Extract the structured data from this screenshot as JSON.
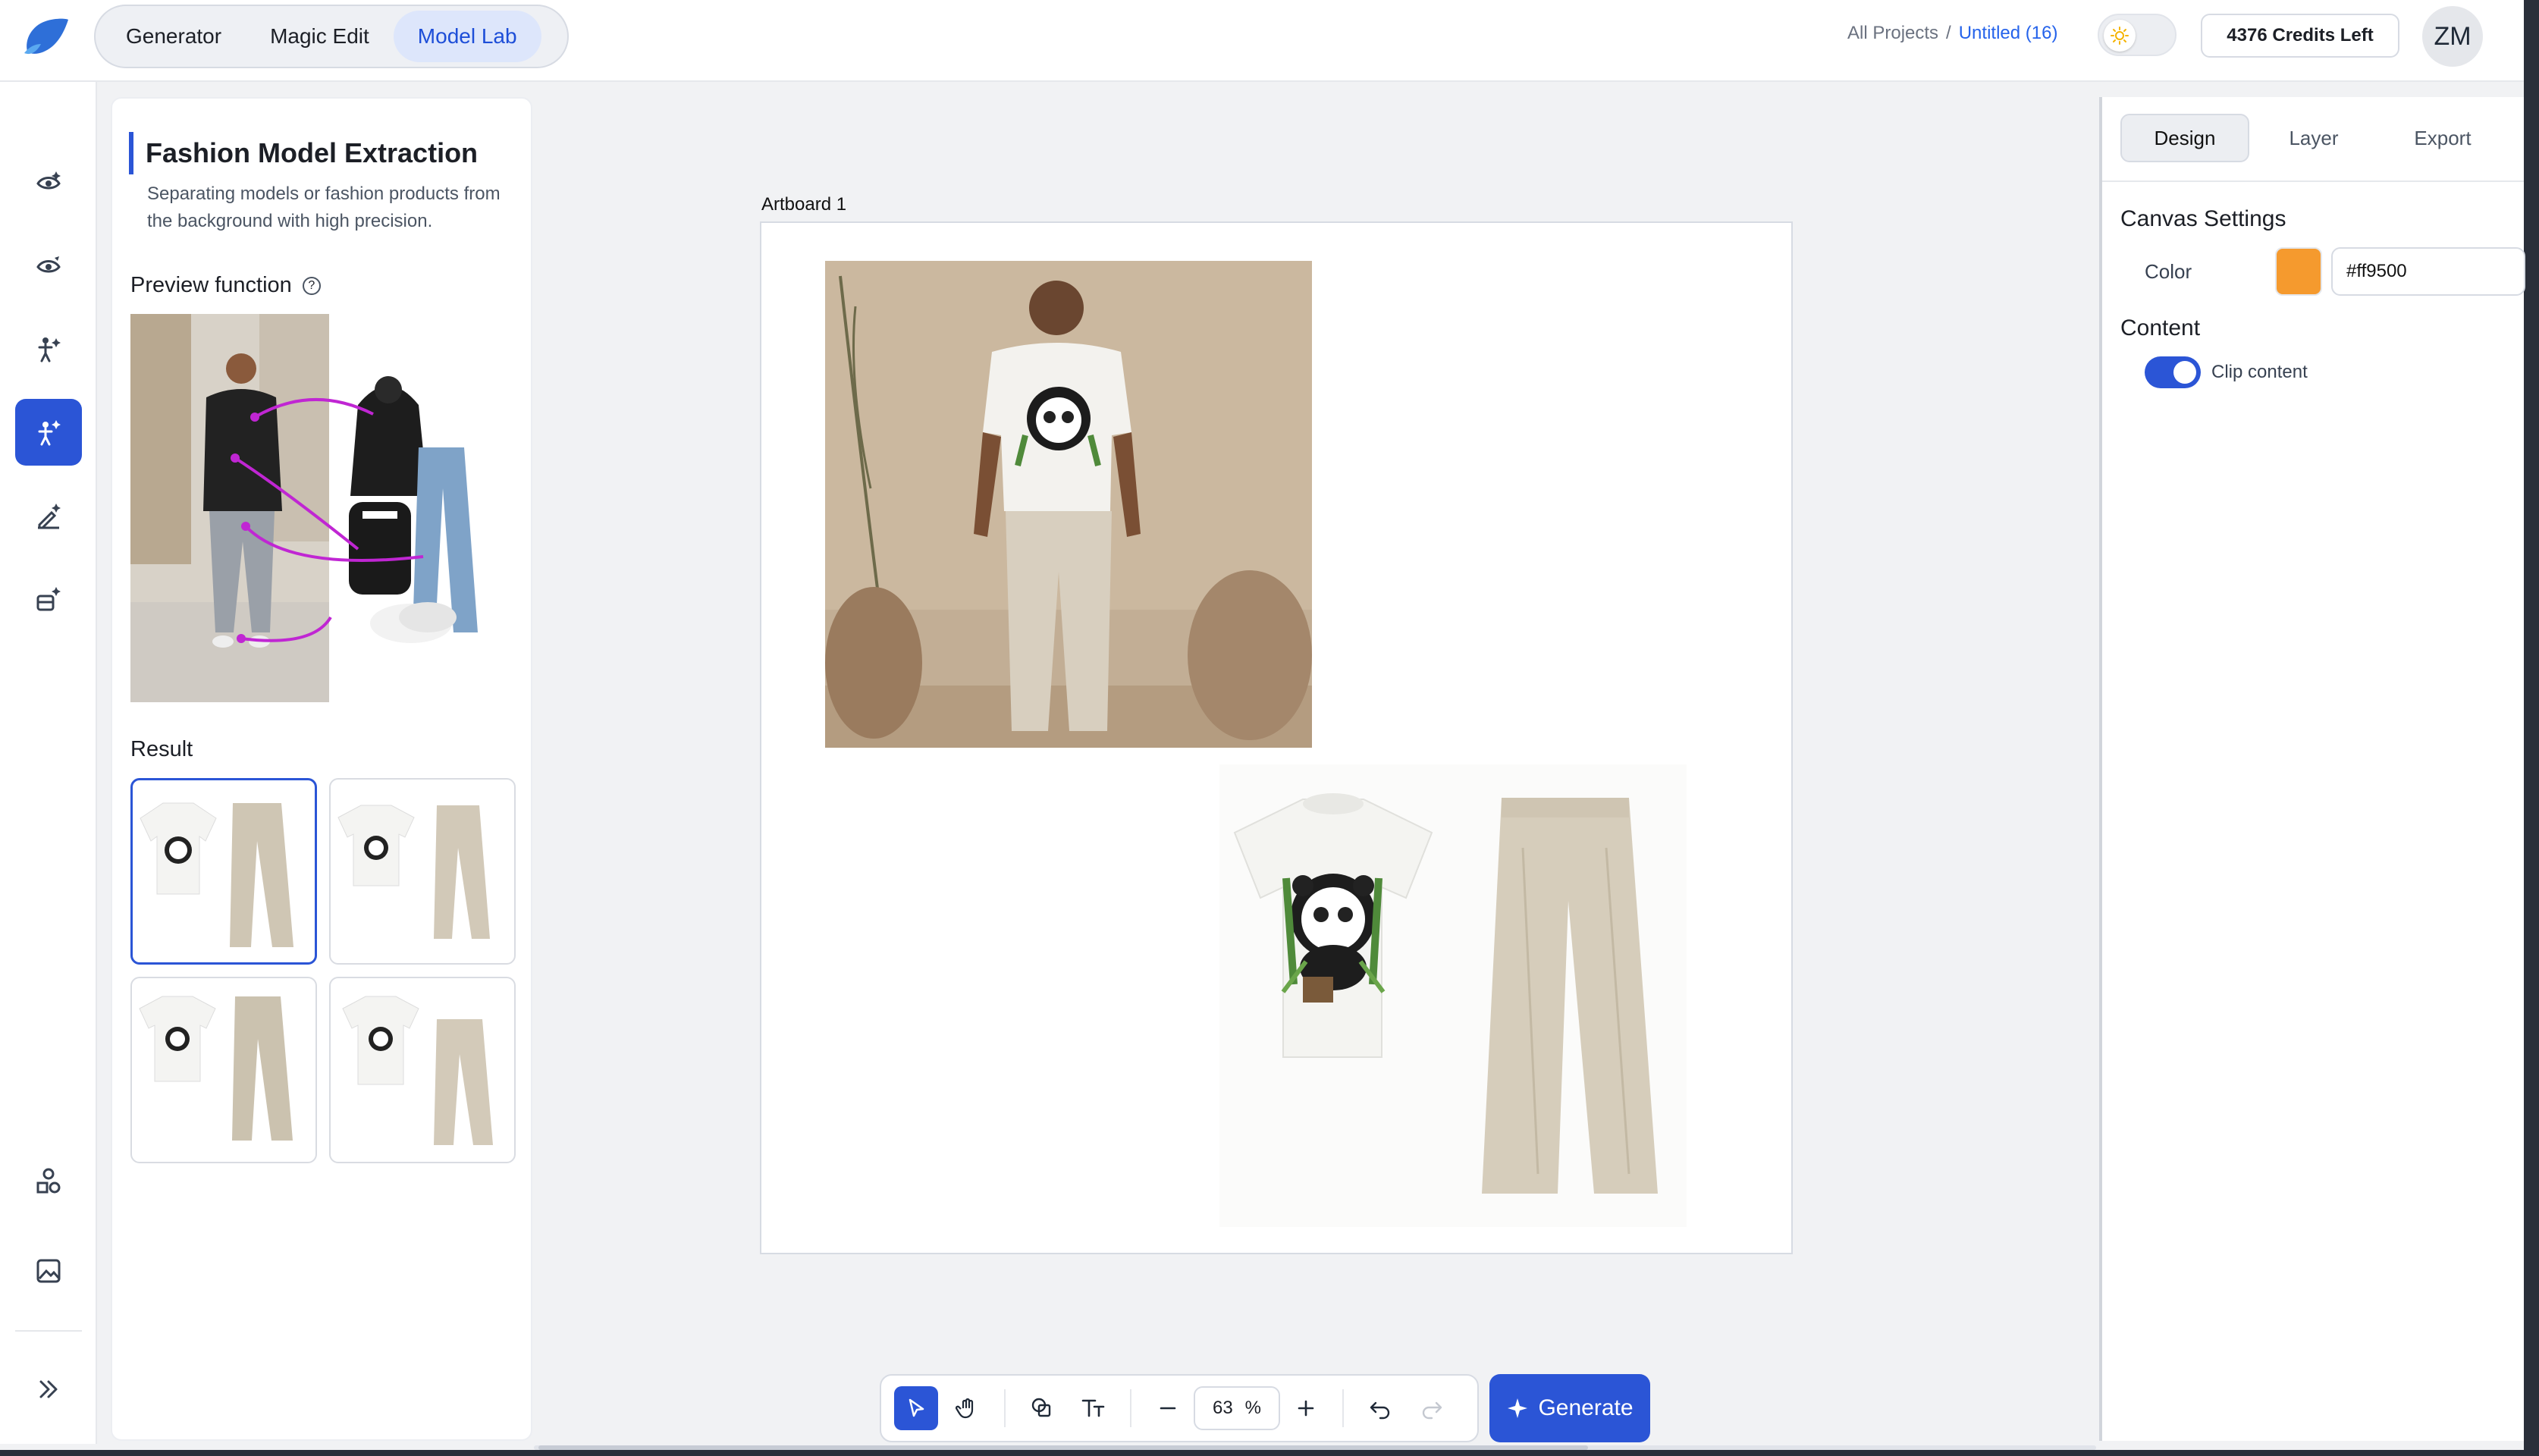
{
  "header": {
    "modes": [
      {
        "label": "Generator",
        "active": false
      },
      {
        "label": "Magic Edit",
        "active": false
      },
      {
        "label": "Model Lab",
        "active": true
      }
    ],
    "breadcrumb": {
      "root": "All Projects",
      "separator": "/",
      "current": "Untitled (16)"
    },
    "credits": "4376 Credits Left",
    "avatar_initials": "ZM"
  },
  "rail": {
    "icons": [
      "eye-sparkle-icon",
      "eye-edit-icon",
      "pose-sparkle-icon",
      "model-extract-icon",
      "brush-sparkle-icon",
      "product-sparkle-icon",
      "shapes-icon",
      "gallery-icon",
      "expand-icon"
    ],
    "active_index": 3
  },
  "left_panel": {
    "title": "Fashion Model Extraction",
    "description": "Separating models or fashion products from the background with high precision.",
    "preview_label": "Preview function",
    "help_glyph": "?",
    "result_label": "Result"
  },
  "canvas": {
    "artboard_label": "Artboard 1"
  },
  "right_panel": {
    "tabs": [
      {
        "label": "Design",
        "active": true
      },
      {
        "label": "Layer",
        "active": false
      },
      {
        "label": "Export",
        "active": false
      }
    ],
    "canvas_settings_title": "Canvas Settings",
    "color_label": "Color",
    "color_value": "#ff9500",
    "swatch_color": "#f59a2e",
    "content_title": "Content",
    "clip_label": "Clip content",
    "clip_enabled": true
  },
  "toolbar": {
    "zoom_value": "63",
    "zoom_unit": "%",
    "generate_label": "Generate"
  },
  "colors": {
    "accent": "#2b55d6",
    "magenta_arrow": "#c026d3"
  }
}
